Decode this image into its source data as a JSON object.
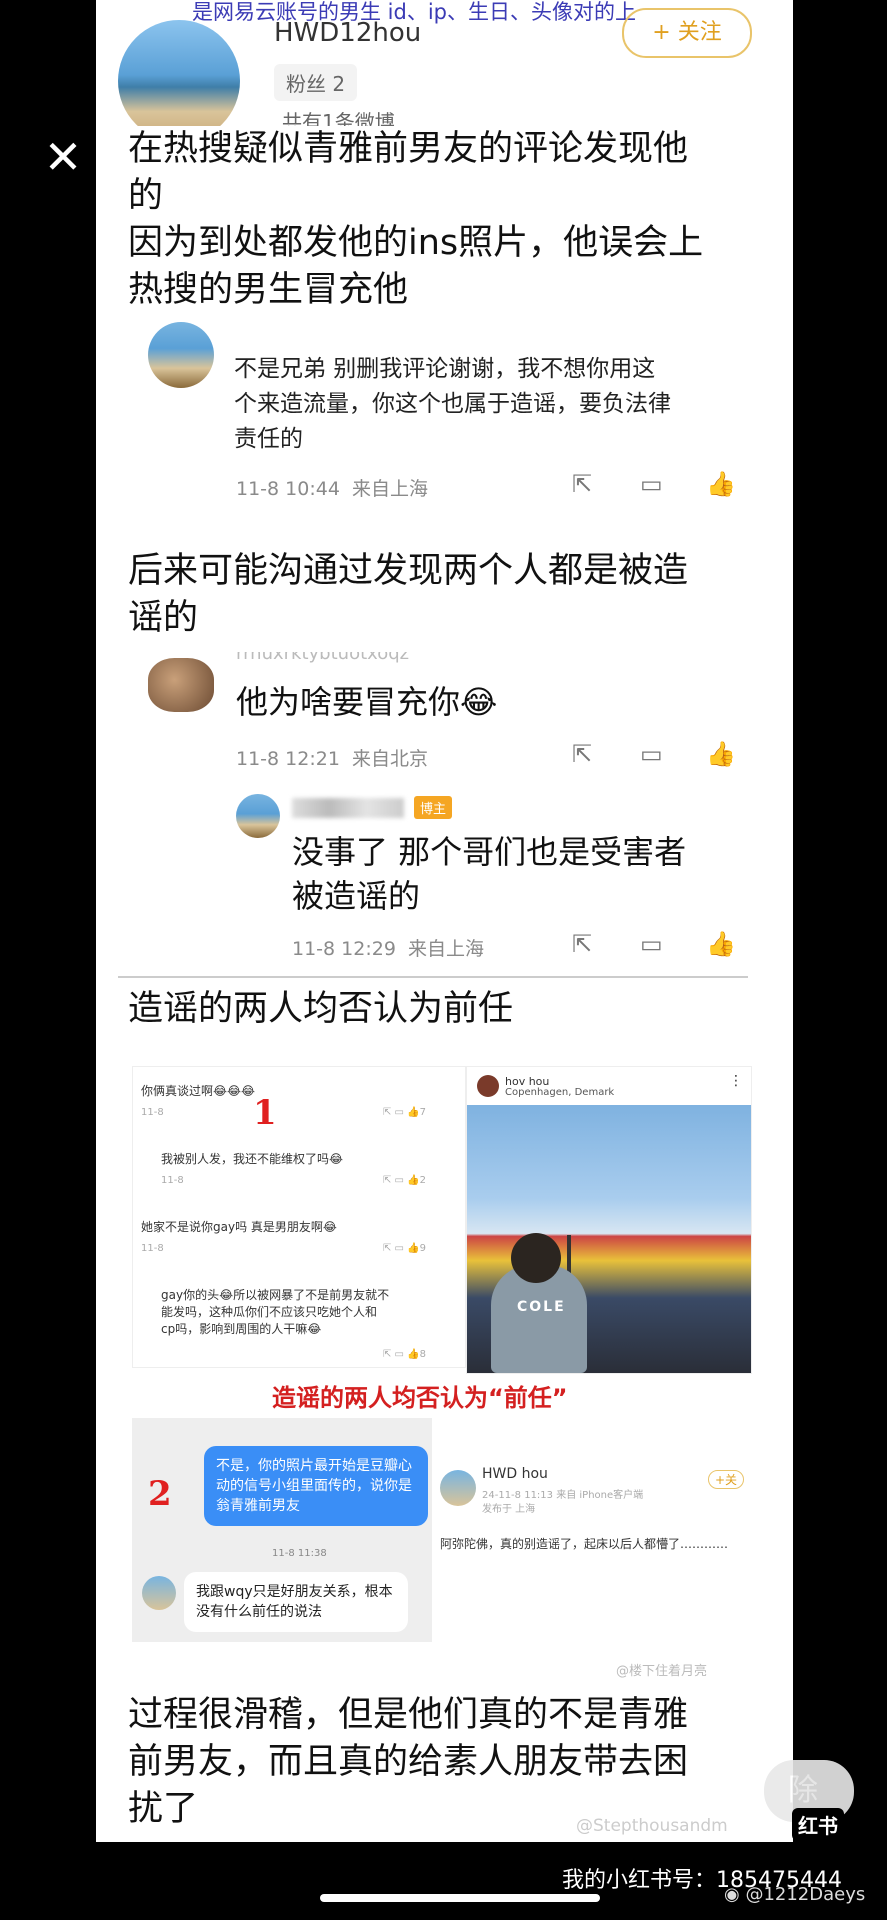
{
  "top_banner": "是网易云账号的男生 id、ip、生日、头像对的上",
  "profile": {
    "username": "HWD12hou",
    "fans": "粉丝 2",
    "weibo_count": "共有1条微博",
    "follow_button": "+ 关注"
  },
  "paragraph1": [
    "在热搜疑似青雅前男友的评论发现他",
    "的",
    "因为到处都发他的ins照片，他误会上",
    "热搜的男生冒充他"
  ],
  "comment1": {
    "text_lines": [
      "不是兄弟 别删我评论谢谢，我不想你用这",
      "个来造流量，你这个也属于造谣，要负法律",
      "责任的"
    ],
    "time": "11-8 10:44",
    "location": "来自上海"
  },
  "paragraph2": [
    "后来可能沟通过发现两个人都是被造",
    "谣的"
  ],
  "comment2": {
    "username": "rrnuxrktybtuotxoqz",
    "text": "他为啥要冒充你😂",
    "time": "11-8 12:21",
    "location": "来自北京"
  },
  "reply": {
    "badge": "博主",
    "text_lines": [
      "没事了 那个哥们也是受害者",
      "被造谣的"
    ],
    "time": "11-8 12:29",
    "location": "来自上海"
  },
  "paragraph3": "造谣的两人均否认为前任",
  "collage": {
    "left_top": {
      "q1": "你俩真谈过啊😂😂😂",
      "num1": "1",
      "r1": "我被别人发，我还不能维权了吗😂",
      "q2": "她家不是说你gay吗 真是男朋友啊😂",
      "r2_lines": [
        "gay你的头😂所以被网暴了不是前男友就不",
        "能发吗，这种瓜你们不应该只吃她个人和",
        "cp吗，影响到周围的人干嘛😂"
      ],
      "time": "11-8",
      "likes1": "7",
      "likes2": "2",
      "likes3": "9",
      "likes4": "8"
    },
    "right_top": {
      "username": "hov    hou",
      "location": "Copenhagen, Demark",
      "shirt_text": "COLE"
    },
    "caption": "造谣的两人均否认为“前任”",
    "left_bottom": {
      "num2": "2",
      "blue_bubble": "不是，你的照片最开始是豆瓣心动的信号小组里面传的，说你是翁青雅前男友",
      "time": "11-8 11:38",
      "white_bubble": "我跟wqy只是好朋友关系，根本没有什么前任的说法"
    },
    "right_bottom": {
      "username": "HWD    hou",
      "meta": "24-11-8 11:13 来自 iPhone客户端",
      "published": "发布于 上海",
      "text": "阿弥陀佛，真的别造谣了，起床以后人都懵了…………",
      "follow": "+关"
    },
    "watermark": "@楼下住着月亮"
  },
  "paragraph4": [
    "过程很滑稽，但是他们真的不是青雅",
    "前男友，而且真的给素人朋友带去困",
    "扰了"
  ],
  "watermark_bottom": "@Stepthousandm",
  "delete_button": "除",
  "xhs_logo": "红书",
  "footer": "我的小红书号：185475444",
  "footer_handle": "@1212Daeys"
}
